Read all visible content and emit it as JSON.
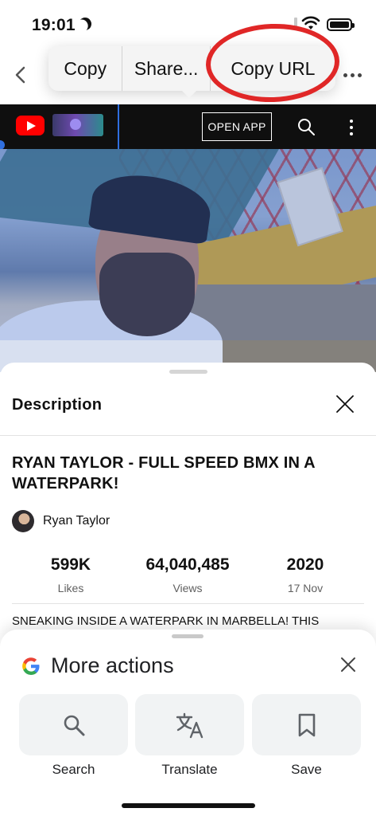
{
  "status_bar": {
    "time": "19:01"
  },
  "callout_menu": {
    "items": [
      {
        "label": "Copy"
      },
      {
        "label": "Share..."
      },
      {
        "label": "Copy URL"
      }
    ]
  },
  "youtube": {
    "open_app_label": "OPEN APP"
  },
  "description_panel": {
    "title": "Description",
    "video_title": "RYAN TAYLOR - FULL SPEED BMX IN A WATERPARK!",
    "channel": "Ryan Taylor",
    "stats": [
      {
        "value": "599K",
        "label": "Likes"
      },
      {
        "value": "64,040,485",
        "label": "Views"
      },
      {
        "value": "2020",
        "label": "17 Nov"
      }
    ],
    "body_preview": "SNEAKING INSIDE A WATERPARK IN MARBELLA! THIS"
  },
  "more_actions": {
    "title": "More actions",
    "actions": [
      {
        "label": "Search",
        "icon": "search-icon"
      },
      {
        "label": "Translate",
        "icon": "translate-icon"
      },
      {
        "label": "Save",
        "icon": "bookmark-icon"
      }
    ]
  },
  "colors": {
    "highlight_circle": "#e02727",
    "selection_blue": "#2f6fe0",
    "youtube_red": "#ff0000"
  }
}
